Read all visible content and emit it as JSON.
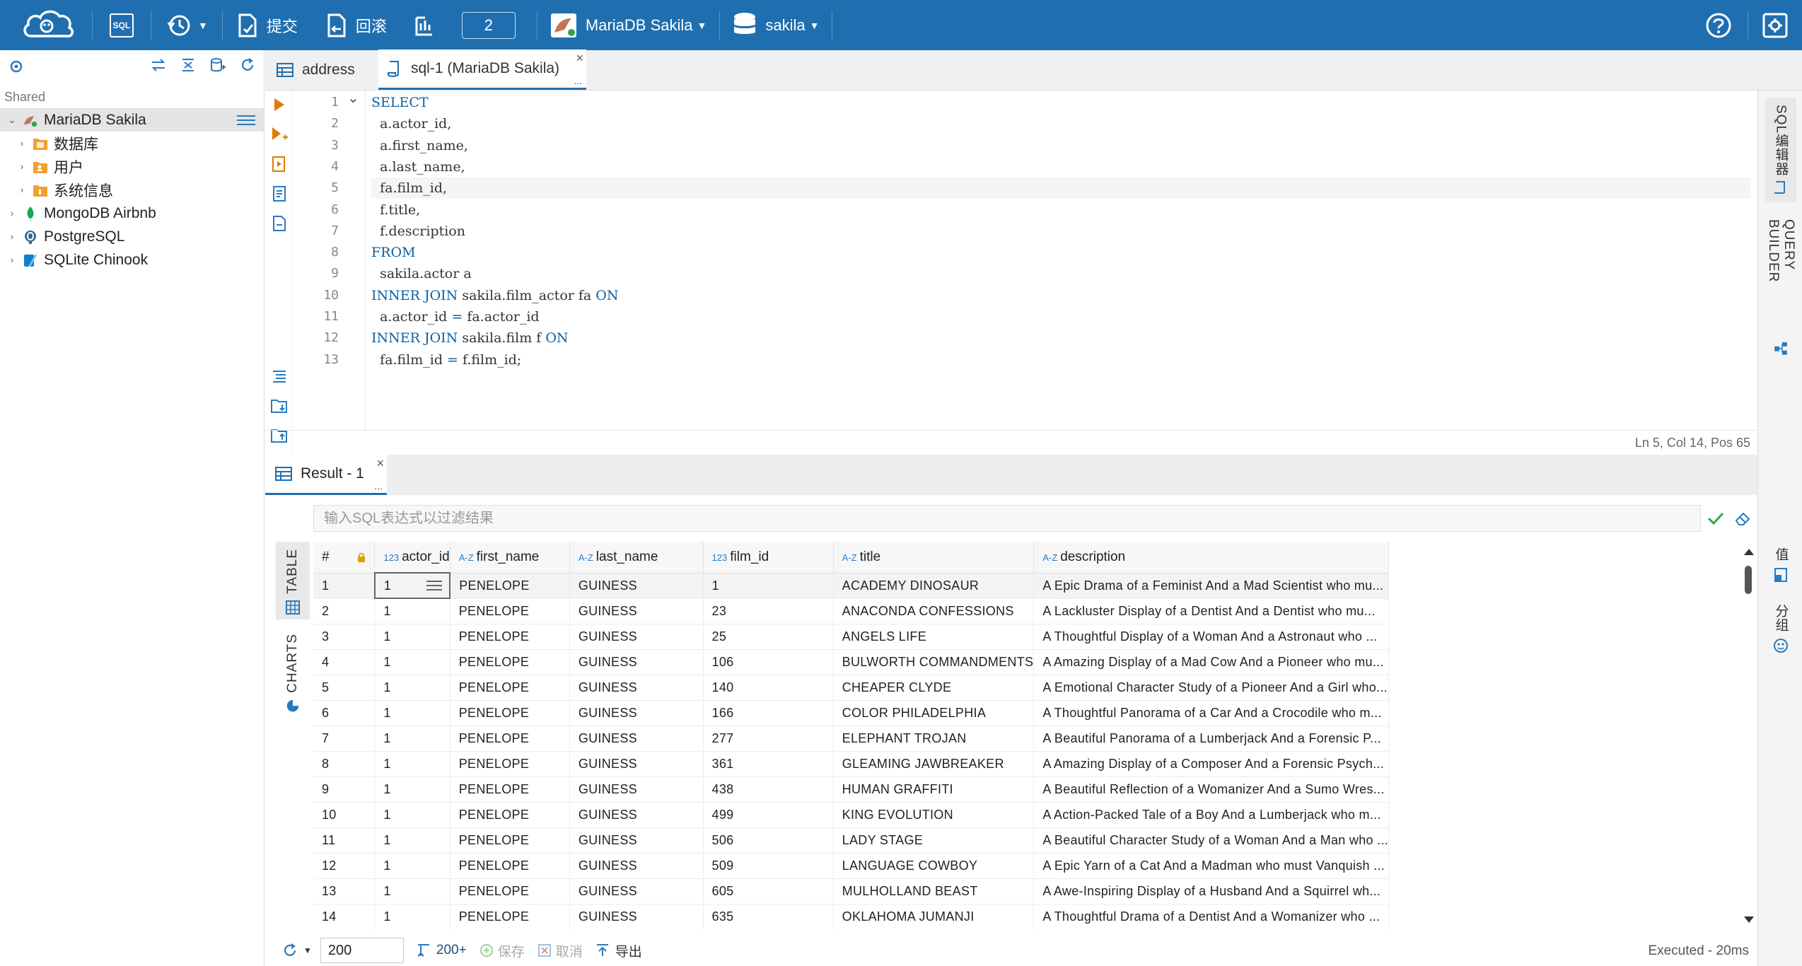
{
  "toolbar": {
    "logo": "cloud-beaver-logo",
    "sql_label": "SQL",
    "commit_label": "提交",
    "rollback_label": "回滚",
    "tx_count": "2",
    "connection_label": "MariaDB Sakila",
    "schema_label": "sakila",
    "colors": {
      "bar": "#1f6fb0"
    }
  },
  "left_panel": {
    "section_label": "Shared",
    "tree": [
      {
        "label": "MariaDB Sakila",
        "icon": "mariadb-icon",
        "level": 0,
        "expanded": true,
        "selected": true
      },
      {
        "label": "数据库",
        "icon": "database-folder-icon",
        "level": 1
      },
      {
        "label": "用户",
        "icon": "users-folder-icon",
        "level": 1
      },
      {
        "label": "系统信息",
        "icon": "system-info-folder-icon",
        "level": 1
      },
      {
        "label": "MongoDB Airbnb",
        "icon": "mongodb-icon",
        "level": 0
      },
      {
        "label": "PostgreSQL",
        "icon": "postgresql-icon",
        "level": 0
      },
      {
        "label": "SQLite Chinook",
        "icon": "sqlite-icon",
        "level": 0
      }
    ]
  },
  "editor_tabs": [
    {
      "label": "address",
      "icon": "table-icon",
      "active": false
    },
    {
      "label": "sql-1 (MariaDB Sakila)",
      "icon": "sql-script-icon",
      "active": true
    }
  ],
  "editor": {
    "lines": [
      {
        "n": "1",
        "tokens": [
          {
            "t": "SELECT",
            "k": "kw"
          }
        ]
      },
      {
        "n": "2",
        "tokens": [
          {
            "t": "  a.actor_id,",
            "k": ""
          }
        ]
      },
      {
        "n": "3",
        "tokens": [
          {
            "t": "  a.first_name,",
            "k": ""
          }
        ]
      },
      {
        "n": "4",
        "tokens": [
          {
            "t": "  a.last_name,",
            "k": ""
          }
        ]
      },
      {
        "n": "5",
        "tokens": [
          {
            "t": "  fa.film_id,",
            "k": ""
          }
        ]
      },
      {
        "n": "6",
        "tokens": [
          {
            "t": "  f.title,",
            "k": ""
          }
        ]
      },
      {
        "n": "7",
        "tokens": [
          {
            "t": "  f.description",
            "k": ""
          }
        ]
      },
      {
        "n": "8",
        "tokens": [
          {
            "t": "FROM",
            "k": "kw"
          }
        ]
      },
      {
        "n": "9",
        "tokens": [
          {
            "t": "  sakila.actor a",
            "k": ""
          }
        ]
      },
      {
        "n": "10",
        "tokens": [
          {
            "t": "INNER JOIN",
            "k": "kw"
          },
          {
            "t": " sakila.film_actor fa ",
            "k": ""
          },
          {
            "t": "ON",
            "k": "kw"
          }
        ]
      },
      {
        "n": "11",
        "tokens": [
          {
            "t": "  a.actor_id ",
            "k": ""
          },
          {
            "t": "=",
            "k": "kw"
          },
          {
            "t": " fa.actor_id",
            "k": ""
          }
        ]
      },
      {
        "n": "12",
        "tokens": [
          {
            "t": "INNER JOIN",
            "k": "kw"
          },
          {
            "t": " sakila.film f ",
            "k": ""
          },
          {
            "t": "ON",
            "k": "kw"
          }
        ]
      },
      {
        "n": "13",
        "tokens": [
          {
            "t": "  fa.film_id ",
            "k": ""
          },
          {
            "t": "=",
            "k": "kw"
          },
          {
            "t": " f.film_id;",
            "k": ""
          }
        ]
      }
    ],
    "current_line": "5",
    "cursor_status": "Ln 5, Col 14, Pos 65"
  },
  "right_rail": {
    "sql_editor_label": "SQL编辑器",
    "query_builder_label": "QUERY BUILDER",
    "value_label": "值",
    "group_label": "分组"
  },
  "result": {
    "tab_label": "Result - 1",
    "filter_placeholder": "输入SQL表达式以过滤结果",
    "view_tabs": {
      "table": "TABLE",
      "charts": "CHARTS"
    },
    "columns": [
      {
        "label": "#",
        "type": ""
      },
      {
        "label": "",
        "type": "lock"
      },
      {
        "label": "actor_id",
        "type": "123"
      },
      {
        "label": "first_name",
        "type": "A-Z"
      },
      {
        "label": "last_name",
        "type": "A-Z"
      },
      {
        "label": "film_id",
        "type": "123"
      },
      {
        "label": "title",
        "type": "A-Z"
      },
      {
        "label": "description",
        "type": "A-Z"
      }
    ],
    "rows": [
      [
        "1",
        "1",
        "PENELOPE",
        "GUINESS",
        "1",
        "ACADEMY DINOSAUR",
        "A Epic Drama of a Feminist And a Mad Scientist who mu..."
      ],
      [
        "2",
        "1",
        "PENELOPE",
        "GUINESS",
        "23",
        "ANACONDA CONFESSIONS",
        "A Lackluster Display of a Dentist And a Dentist who mu..."
      ],
      [
        "3",
        "1",
        "PENELOPE",
        "GUINESS",
        "25",
        "ANGELS LIFE",
        "A Thoughtful Display of a Woman And a Astronaut who ..."
      ],
      [
        "4",
        "1",
        "PENELOPE",
        "GUINESS",
        "106",
        "BULWORTH COMMANDMENTS",
        "A Amazing Display of a Mad Cow And a Pioneer who mu..."
      ],
      [
        "5",
        "1",
        "PENELOPE",
        "GUINESS",
        "140",
        "CHEAPER CLYDE",
        "A Emotional Character Study of a Pioneer And a Girl who..."
      ],
      [
        "6",
        "1",
        "PENELOPE",
        "GUINESS",
        "166",
        "COLOR PHILADELPHIA",
        "A Thoughtful Panorama of a Car And a Crocodile who m..."
      ],
      [
        "7",
        "1",
        "PENELOPE",
        "GUINESS",
        "277",
        "ELEPHANT TROJAN",
        "A Beautiful Panorama of a Lumberjack And a Forensic P..."
      ],
      [
        "8",
        "1",
        "PENELOPE",
        "GUINESS",
        "361",
        "GLEAMING JAWBREAKER",
        "A Amazing Display of a Composer And a Forensic Psych..."
      ],
      [
        "9",
        "1",
        "PENELOPE",
        "GUINESS",
        "438",
        "HUMAN GRAFFITI",
        "A Beautiful Reflection of a Womanizer And a Sumo Wres..."
      ],
      [
        "10",
        "1",
        "PENELOPE",
        "GUINESS",
        "499",
        "KING EVOLUTION",
        "A Action-Packed Tale of a Boy And a Lumberjack who m..."
      ],
      [
        "11",
        "1",
        "PENELOPE",
        "GUINESS",
        "506",
        "LADY STAGE",
        "A Beautiful Character Study of a Woman And a Man who ..."
      ],
      [
        "12",
        "1",
        "PENELOPE",
        "GUINESS",
        "509",
        "LANGUAGE COWBOY",
        "A Epic Yarn of a Cat And a Madman who must Vanquish ..."
      ],
      [
        "13",
        "1",
        "PENELOPE",
        "GUINESS",
        "605",
        "MULHOLLAND BEAST",
        "A Awe-Inspiring Display of a Husband And a Squirrel wh..."
      ],
      [
        "14",
        "1",
        "PENELOPE",
        "GUINESS",
        "635",
        "OKLAHOMA JUMANJI",
        "A Thoughtful Drama of a Dentist And a Womanizer who ..."
      ]
    ],
    "selected_row": "1",
    "footer": {
      "limit_value": "200",
      "fetch_more_label": "200+",
      "save_label": "保存",
      "cancel_label": "取消",
      "export_label": "导出",
      "status": "Executed - 20ms"
    }
  }
}
